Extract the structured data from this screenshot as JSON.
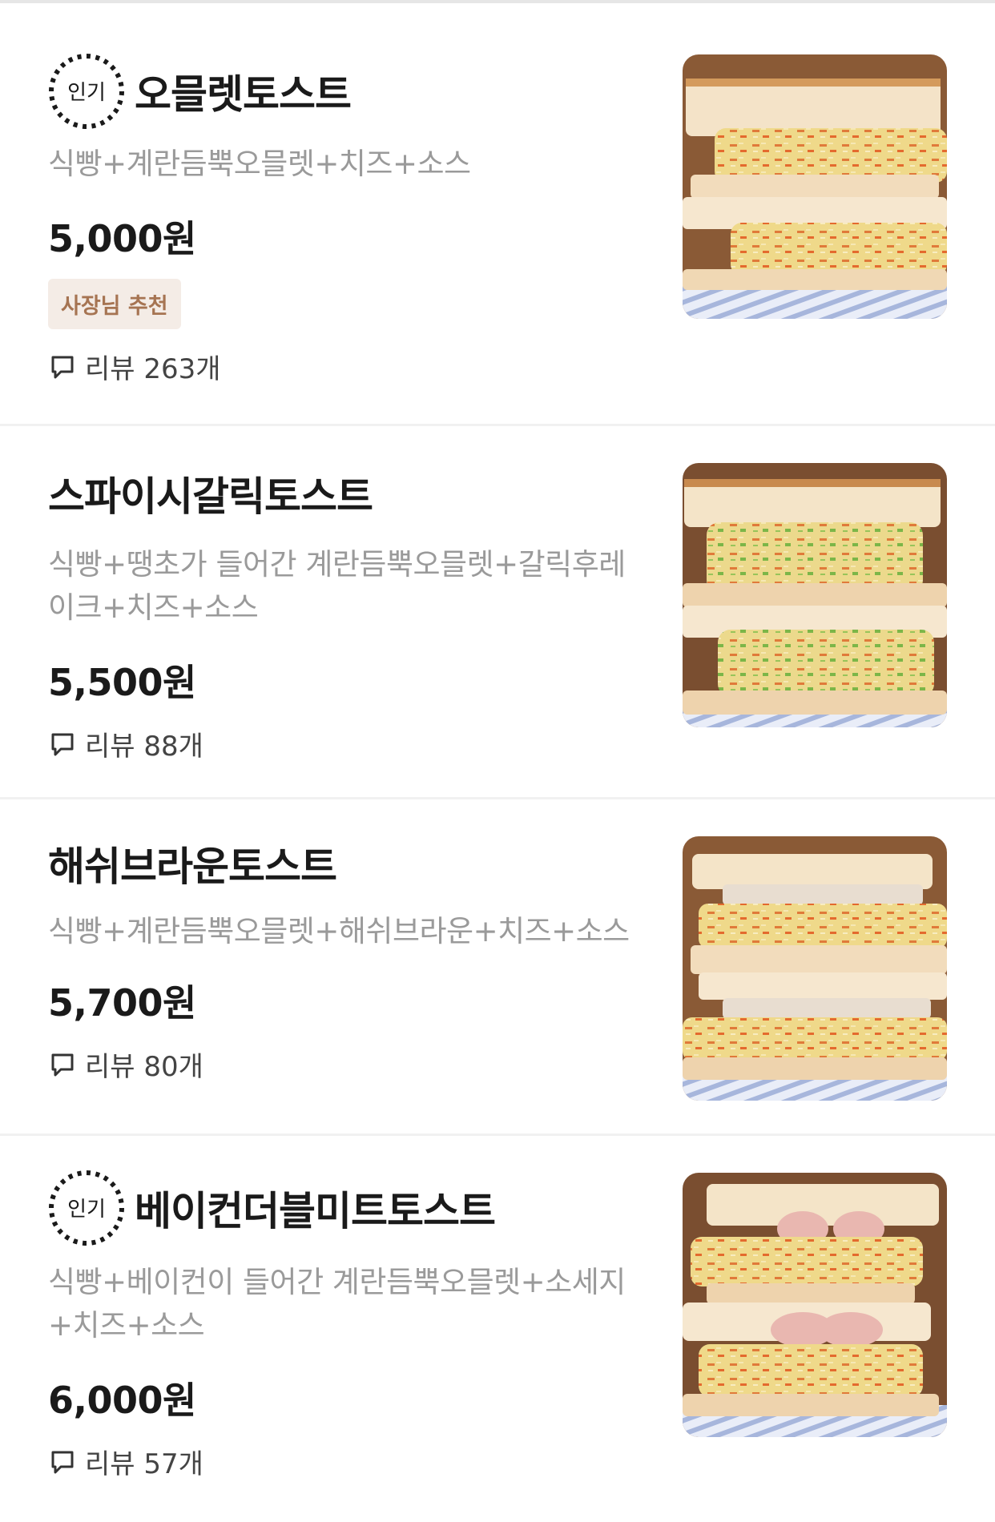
{
  "items": [
    {
      "popular": true,
      "popular_label": "인기",
      "name": "오믈렛토스트",
      "description": "식빵+계란듬뿍오믈렛+치즈+소스",
      "price": "5,000원",
      "tag": "사장님 추천",
      "review": "리뷰 263개"
    },
    {
      "popular": false,
      "name": "스파이시갈릭토스트",
      "description": "식빵+땡초가 들어간 계란듬뿍오믈렛+갈릭후레이크+치즈+소스",
      "price": "5,500원",
      "review": "리뷰 88개"
    },
    {
      "popular": false,
      "name": "해쉬브라운토스트",
      "description": "식빵+계란듬뿍오믈렛+해쉬브라운+치즈+소스",
      "price": "5,700원",
      "review": "리뷰 80개"
    },
    {
      "popular": true,
      "popular_label": "인기",
      "name": "베이컨더블미트토스트",
      "description": "식빵+베이컨이 들어간 계란듬뿍오믈렛+소세지+치즈+소스",
      "price": "6,000원",
      "review": "리뷰 57개"
    }
  ],
  "colors": {
    "price": "#1a1a1a",
    "description": "#9a9a9a",
    "tag_bg": "#f4ece6",
    "tag_text": "#a67452",
    "divider": "#f1f1f1"
  },
  "icons": {
    "popular_badge": "dashed-circle-popular-badge",
    "review": "speech-bubble-icon"
  }
}
